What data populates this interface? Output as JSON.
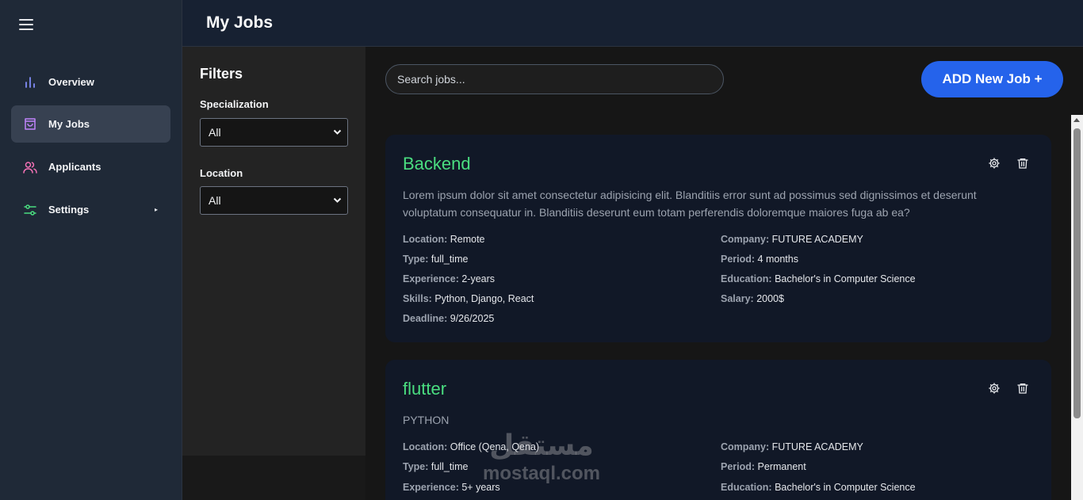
{
  "header": {
    "title": "My Jobs"
  },
  "sidebar": {
    "items": [
      {
        "label": "Overview",
        "icon": "bar-chart-icon",
        "color": "#818cf8"
      },
      {
        "label": "My Jobs",
        "icon": "shopping-bag-icon",
        "color": "#c084fc",
        "active": true
      },
      {
        "label": "Applicants",
        "icon": "users-icon",
        "color": "#f472b6"
      },
      {
        "label": "Settings",
        "icon": "sliders-icon",
        "color": "#4ade80",
        "caret": "▸"
      }
    ]
  },
  "filters": {
    "title": "Filters",
    "specialization": {
      "label": "Specialization",
      "value": "All"
    },
    "location": {
      "label": "Location",
      "value": "All"
    }
  },
  "search": {
    "placeholder": "Search jobs..."
  },
  "add_button": {
    "label": "ADD New Job +"
  },
  "jobs": [
    {
      "title": "Backend",
      "description": "Lorem ipsum dolor sit amet consectetur adipisicing elit. Blanditiis error sunt ad possimus sed dignissimos et deserunt voluptatum consequatur in. Blanditiis deserunt eum totam perferendis doloremque maiores fuga ab ea?",
      "location": {
        "label": "Location:",
        "value": "Remote"
      },
      "type": {
        "label": "Type:",
        "value": "full_time"
      },
      "experience": {
        "label": "Experience:",
        "value": "2-years"
      },
      "skills": {
        "label": "Skills:",
        "value": "Python, Django, React"
      },
      "deadline": {
        "label": "Deadline:",
        "value": "9/26/2025"
      },
      "company": {
        "label": "Company:",
        "value": "FUTURE ACADEMY"
      },
      "period": {
        "label": "Period:",
        "value": "4 months"
      },
      "education": {
        "label": "Education:",
        "value": "Bachelor's in Computer Science"
      },
      "salary": {
        "label": "Salary:",
        "value": "2000$"
      }
    },
    {
      "title": "flutter",
      "description": "PYTHON",
      "location": {
        "label": "Location:",
        "value": "Office (Qena, Qena)"
      },
      "type": {
        "label": "Type:",
        "value": "full_time"
      },
      "experience": {
        "label": "Experience:",
        "value": "5+ years"
      },
      "company": {
        "label": "Company:",
        "value": "FUTURE ACADEMY"
      },
      "period": {
        "label": "Period:",
        "value": "Permanent"
      },
      "education": {
        "label": "Education:",
        "value": "Bachelor's in Computer Science"
      }
    }
  ],
  "watermark": {
    "arabic": "مستقل",
    "latin": "mostaql.com"
  },
  "colors": {
    "accent": "#2563eb",
    "job_title": "#4ade80",
    "card_bg": "#111827"
  }
}
